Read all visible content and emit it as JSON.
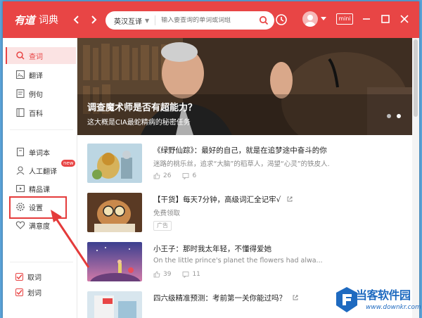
{
  "app": {
    "brand": "有道",
    "title": "词典"
  },
  "search": {
    "mode": "英汉互译",
    "placeholder": "输入要查询的单词或词组"
  },
  "titlebar": {
    "mini_label": "mini"
  },
  "sidebar": {
    "items": [
      {
        "label": "查词",
        "icon": "search-icon"
      },
      {
        "label": "翻译",
        "icon": "translate-icon"
      },
      {
        "label": "例句",
        "icon": "sentence-icon"
      },
      {
        "label": "百科",
        "icon": "encyclopedia-icon"
      },
      {
        "label": "单词本",
        "icon": "wordbook-icon"
      },
      {
        "label": "人工翻译",
        "icon": "human-translate-icon",
        "badge": "new"
      },
      {
        "label": "精品课",
        "icon": "course-icon"
      },
      {
        "label": "设置",
        "icon": "gear-icon"
      },
      {
        "label": "满意度",
        "icon": "heart-icon"
      }
    ],
    "checks": [
      {
        "label": "取词",
        "checked": true
      },
      {
        "label": "划词",
        "checked": true
      }
    ]
  },
  "banner": {
    "title": "调查魔术师是否有超能力？",
    "subtitle": "这大概是CIA最蛇精病的秘密任务"
  },
  "feed": [
    {
      "title": "《绿野仙踪》：最好的自己，就是在追梦途中奋斗的你",
      "subtitle": "迷路的桃乐丝，追求“大脑”的稻草人，渴望“心灵”的铁皮人...",
      "likes": "26",
      "comments": "6"
    },
    {
      "title": "【干货】每天7分钟，高级词汇全记牢√",
      "subtitle": "免费领取",
      "tag": "广告"
    },
    {
      "title": "小王子：那时我太年轻，不懂得爱她",
      "subtitle": "On the little prince's planet the flowers had alwa...",
      "likes": "39",
      "comments": "11"
    },
    {
      "title": "四六级精准预测：考前第一关你能过吗？"
    }
  ],
  "watermark": {
    "name": "当客软件园",
    "url": "www.downkr.com"
  },
  "colors": {
    "accent": "#e84545",
    "highlight_box": "#e43b3b"
  }
}
